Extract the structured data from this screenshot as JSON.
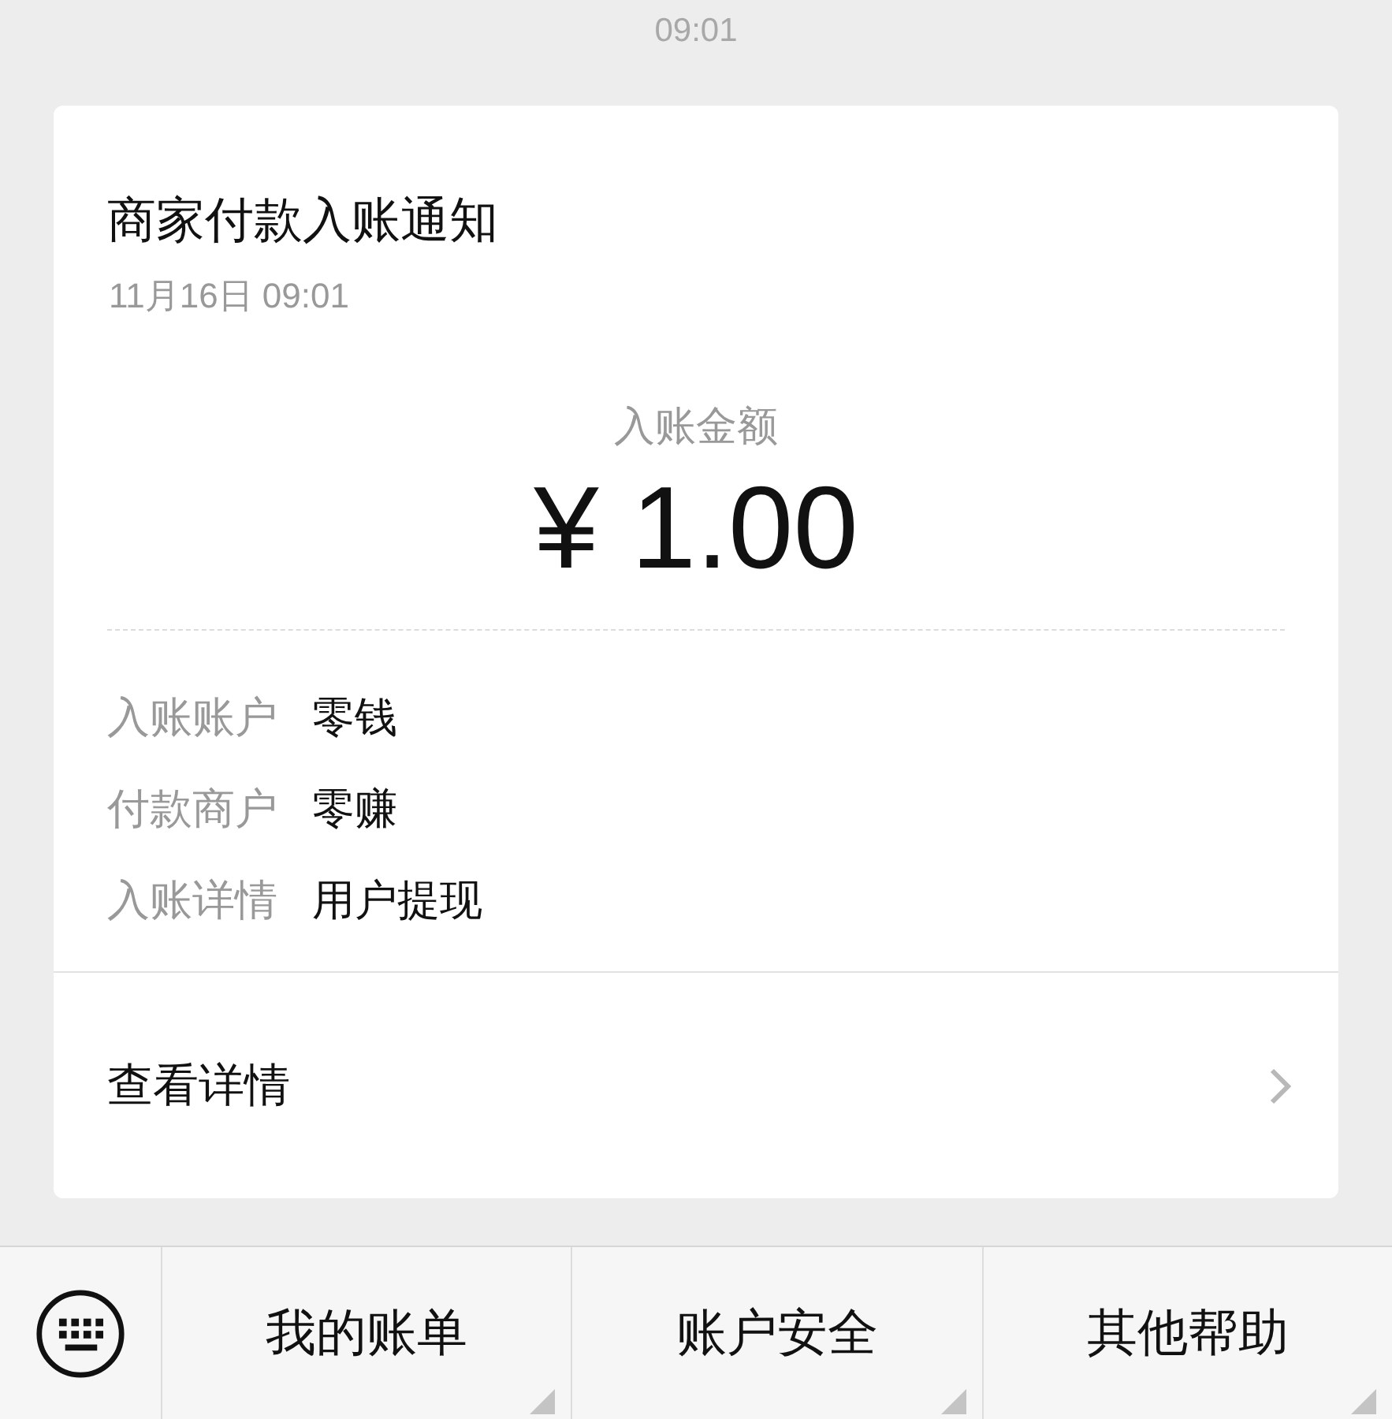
{
  "time": "09:01",
  "card": {
    "title": "商家付款入账通知",
    "date": "11月16日  09:01",
    "amount_label": "入账金额",
    "amount": "¥ 1.00",
    "fields": [
      {
        "label": "入账账户",
        "value": "零钱"
      },
      {
        "label": "付款商户",
        "value": "零赚"
      },
      {
        "label": "入账详情",
        "value": "用户提现"
      }
    ],
    "link": "查看详情"
  },
  "menu": {
    "items": [
      {
        "label": "我的账单"
      },
      {
        "label": "账户安全"
      },
      {
        "label": "其他帮助"
      }
    ]
  }
}
